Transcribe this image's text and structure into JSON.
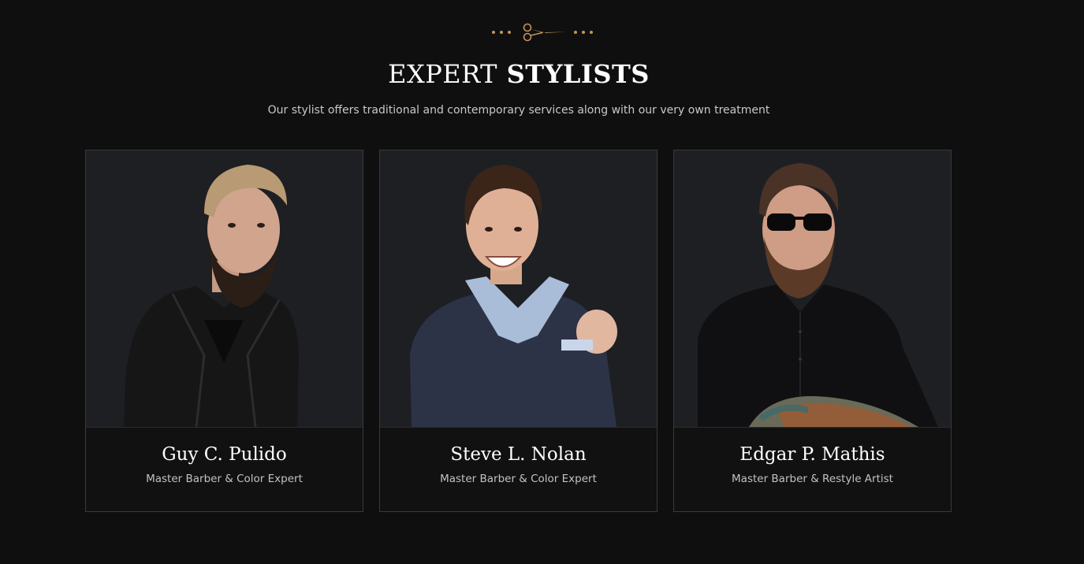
{
  "section": {
    "title_light": "EXPERT",
    "title_bold": "STYLISTS",
    "subtitle": "Our stylist offers traditional and contemporary services along with our very own treatment"
  },
  "icons": {
    "ornament": "scissors-icon"
  },
  "colors": {
    "accent": "#c29557",
    "background": "#0f0f10",
    "card_photo_bg": "#1e1f22"
  },
  "stylists": [
    {
      "name": "Guy C. Pulido",
      "role": "Master Barber & Color Expert"
    },
    {
      "name": "Steve L. Nolan",
      "role": "Master Barber & Color Expert"
    },
    {
      "name": "Edgar P. Mathis",
      "role": "Master Barber & Restyle Artist"
    }
  ]
}
